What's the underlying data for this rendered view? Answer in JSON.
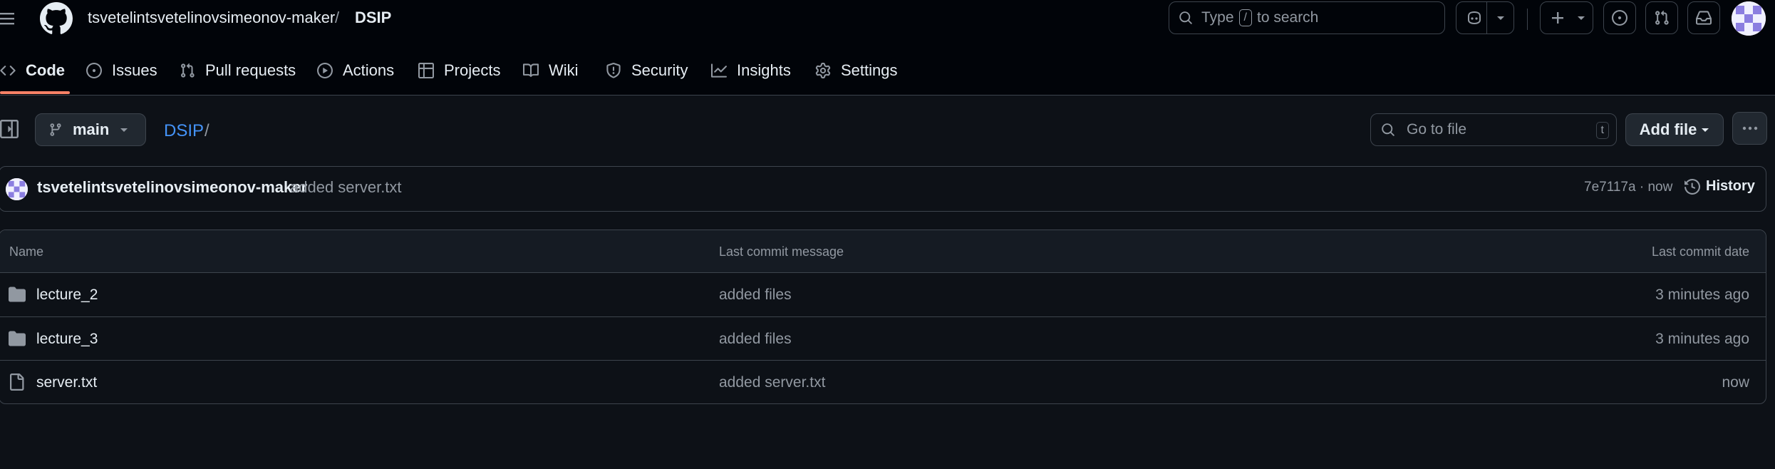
{
  "header": {
    "owner": "tsvetelintsvetelinovsimeonov-maker",
    "separator": "/",
    "repo": "DSIP",
    "search_prefix": "Type",
    "search_key": "/",
    "search_suffix": "to search"
  },
  "repo_nav": {
    "tabs": [
      {
        "label": "Code",
        "icon": "code-icon",
        "selected": true
      },
      {
        "label": "Issues",
        "icon": "issue-opened-icon"
      },
      {
        "label": "Pull requests",
        "icon": "git-pull-request-icon"
      },
      {
        "label": "Actions",
        "icon": "play-icon"
      },
      {
        "label": "Projects",
        "icon": "table-icon"
      },
      {
        "label": "Wiki",
        "icon": "book-icon"
      },
      {
        "label": "Security",
        "icon": "shield-icon"
      },
      {
        "label": "Insights",
        "icon": "graph-icon"
      },
      {
        "label": "Settings",
        "icon": "gear-icon"
      }
    ]
  },
  "file_nav": {
    "branch": "main",
    "path_repo": "DSIP",
    "path_sep": "/",
    "goto_placeholder": "Go to file",
    "goto_key": "t",
    "add_file": "Add file"
  },
  "latest_commit": {
    "author": "tsvetelintsvetelinovsimeonov-maker",
    "message": "added server.txt",
    "meta": "7e7117a · now",
    "history": "History"
  },
  "files": {
    "columns": [
      "Name",
      "Last commit message",
      "Last commit date"
    ],
    "rows": [
      {
        "type": "directory",
        "name": "lecture_2",
        "message": "added files",
        "date": "3 minutes ago"
      },
      {
        "type": "directory",
        "name": "lecture_3",
        "message": "added files",
        "date": "3 minutes ago"
      },
      {
        "type": "file",
        "name": "server.txt",
        "message": "added server.txt",
        "date": "now"
      }
    ]
  },
  "colors": {
    "background": "#0d1117",
    "header": "#010409",
    "accent_link": "#4493f8",
    "tab_underline": "#f78166",
    "muted_text": "#9198a1",
    "border": "#3d444d"
  }
}
